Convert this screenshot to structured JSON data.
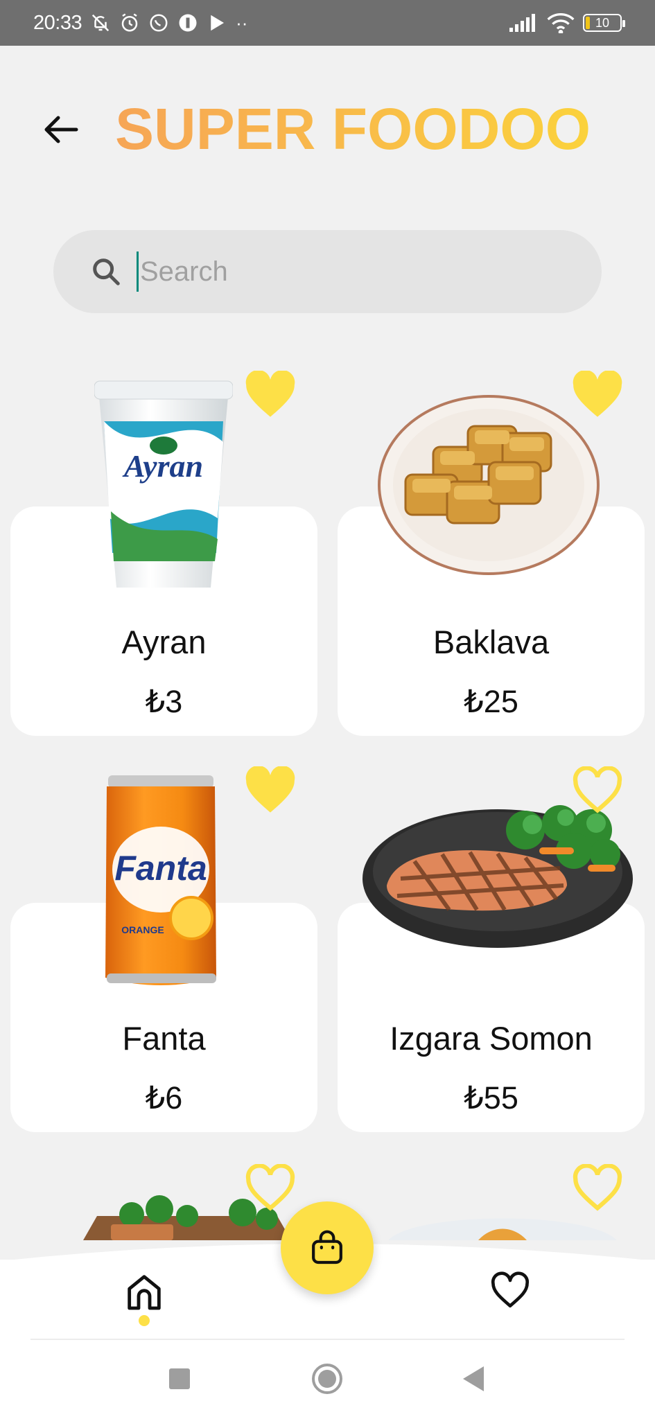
{
  "status_bar": {
    "time": "20:33",
    "icons_left": [
      "bell-off-icon",
      "alarm-icon",
      "whatsapp-icon",
      "app-icon",
      "play-icon",
      "more-dots-icon"
    ],
    "battery": "10"
  },
  "header": {
    "title": "SUPER FOODOO"
  },
  "search": {
    "placeholder": "Search",
    "value": ""
  },
  "products": [
    {
      "name": "Ayran",
      "price": "₺3",
      "favorite": true
    },
    {
      "name": "Baklava",
      "price": "₺25",
      "favorite": true
    },
    {
      "name": "Fanta",
      "price": "₺6",
      "favorite": true
    },
    {
      "name": "Izgara Somon",
      "price": "₺55",
      "favorite": false
    },
    {
      "name": "",
      "price": "",
      "favorite": false
    },
    {
      "name": "",
      "price": "",
      "favorite": false
    }
  ],
  "colors": {
    "accent": "#fde047",
    "title_gradient_start": "#f6a556",
    "title_gradient_end": "#fbd23c",
    "background": "#f1f1f1"
  },
  "bottom_nav": {
    "items": [
      "home-icon",
      "shopping-bag-icon",
      "heart-icon"
    ],
    "active": "home"
  }
}
